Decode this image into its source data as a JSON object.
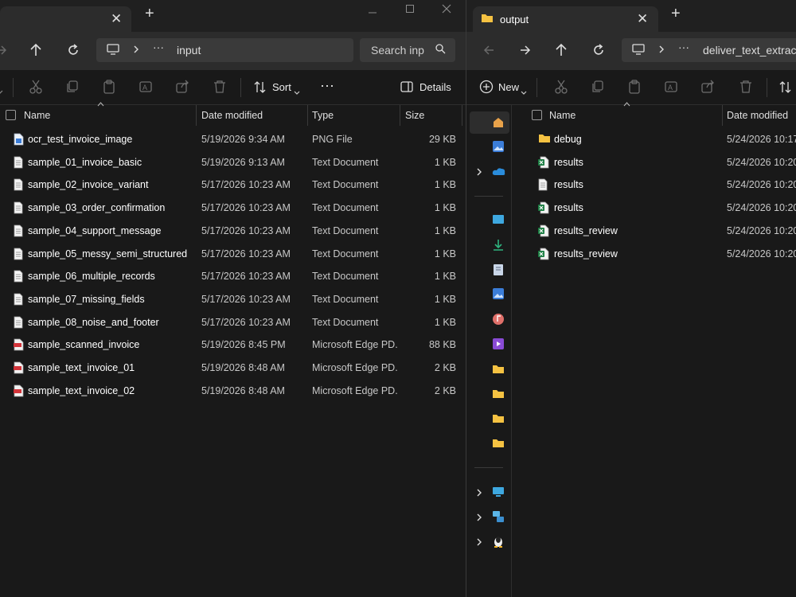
{
  "left_window": {
    "close_tab_glyph": "✕",
    "new_tab_glyph": "+",
    "address": {
      "segment_more": "···",
      "current": "input"
    },
    "search": {
      "placeholder": "Search inp"
    },
    "toolbar": {
      "sort_label": "Sort",
      "more_label": "···",
      "details_label": "Details"
    },
    "columns": {
      "name": "Name",
      "date": "Date modified",
      "type": "Type",
      "size": "Size"
    },
    "files": [
      {
        "name": "ocr_test_invoice_image",
        "date": "5/19/2026 9:34 AM",
        "type": "PNG File",
        "size": "29 KB",
        "icon": "png-file-icon"
      },
      {
        "name": "sample_01_invoice_basic",
        "date": "5/19/2026 9:13 AM",
        "type": "Text Document",
        "size": "1 KB",
        "icon": "text-file-icon"
      },
      {
        "name": "sample_02_invoice_variant",
        "date": "5/17/2026 10:23 AM",
        "type": "Text Document",
        "size": "1 KB",
        "icon": "text-file-icon"
      },
      {
        "name": "sample_03_order_confirmation",
        "date": "5/17/2026 10:23 AM",
        "type": "Text Document",
        "size": "1 KB",
        "icon": "text-file-icon"
      },
      {
        "name": "sample_04_support_message",
        "date": "5/17/2026 10:23 AM",
        "type": "Text Document",
        "size": "1 KB",
        "icon": "text-file-icon"
      },
      {
        "name": "sample_05_messy_semi_structured",
        "date": "5/17/2026 10:23 AM",
        "type": "Text Document",
        "size": "1 KB",
        "icon": "text-file-icon"
      },
      {
        "name": "sample_06_multiple_records",
        "date": "5/17/2026 10:23 AM",
        "type": "Text Document",
        "size": "1 KB",
        "icon": "text-file-icon"
      },
      {
        "name": "sample_07_missing_fields",
        "date": "5/17/2026 10:23 AM",
        "type": "Text Document",
        "size": "1 KB",
        "icon": "text-file-icon"
      },
      {
        "name": "sample_08_noise_and_footer",
        "date": "5/17/2026 10:23 AM",
        "type": "Text Document",
        "size": "1 KB",
        "icon": "text-file-icon"
      },
      {
        "name": "sample_scanned_invoice",
        "date": "5/19/2026 8:45 PM",
        "type": "Microsoft Edge PD...",
        "size": "88 KB",
        "icon": "pdf-file-icon"
      },
      {
        "name": "sample_text_invoice_01",
        "date": "5/19/2026 8:48 AM",
        "type": "Microsoft Edge PD...",
        "size": "2 KB",
        "icon": "pdf-file-icon"
      },
      {
        "name": "sample_text_invoice_02",
        "date": "5/19/2026 8:48 AM",
        "type": "Microsoft Edge PD...",
        "size": "2 KB",
        "icon": "pdf-file-icon"
      }
    ]
  },
  "right_window": {
    "tab_title": "output",
    "close_tab_glyph": "✕",
    "new_tab_glyph": "+",
    "address": {
      "segment_more": "···",
      "current": "deliver_text_extract_"
    },
    "toolbar": {
      "new_label": "New"
    },
    "columns": {
      "name": "Name",
      "date": "Date modified"
    },
    "files": [
      {
        "name": "debug",
        "date": "5/24/2026 10:17",
        "icon": "folder-icon"
      },
      {
        "name": "results",
        "date": "5/24/2026 10:20",
        "icon": "excel-file-icon"
      },
      {
        "name": "results",
        "date": "5/24/2026 10:20",
        "icon": "text-file-icon"
      },
      {
        "name": "results",
        "date": "5/24/2026 10:20",
        "icon": "excel-file-icon"
      },
      {
        "name": "results_review",
        "date": "5/24/2026 10:20",
        "icon": "excel-file-icon"
      },
      {
        "name": "results_review",
        "date": "5/24/2026 10:20",
        "icon": "excel-file-icon"
      }
    ]
  },
  "colors": {
    "folder": "#f5c242",
    "pdf_red": "#d2343a",
    "excel_green": "#1e7f45",
    "png_blue": "#3b7dd8",
    "onedrive_blue": "#2a8cdb"
  }
}
